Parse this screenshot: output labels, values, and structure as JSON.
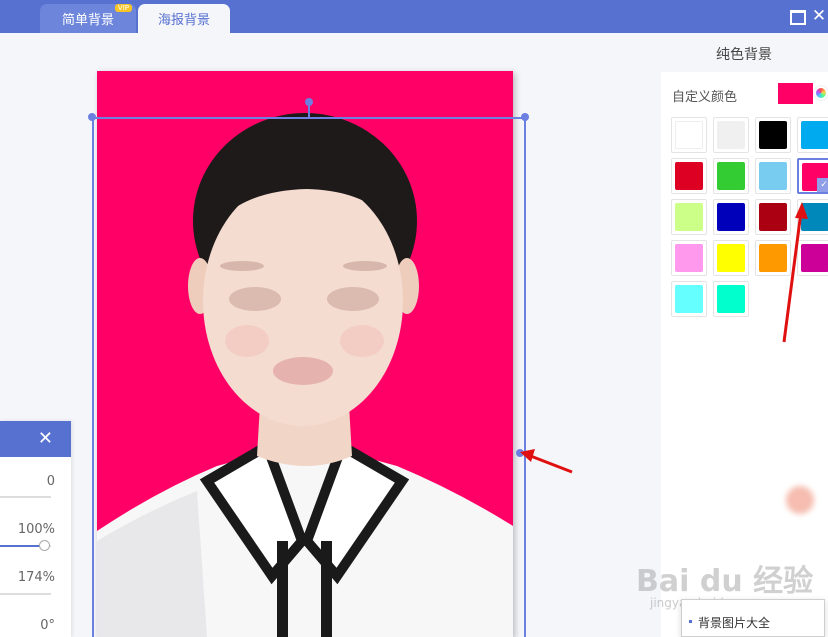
{
  "tabs": [
    {
      "label": "简单背景",
      "badge": "VIP"
    },
    {
      "label": "海报背景"
    }
  ],
  "right_panel": {
    "title": "纯色背景",
    "custom_color_label": "自定义颜色",
    "custom_color": "#ff0066",
    "swatches": [
      "#ffffff",
      "#f0f0f0",
      "#000000",
      "#00aaee",
      "#dd0022",
      "#33cc33",
      "#77ccf0",
      "#ff0066",
      "#ccff88",
      "#0000bb",
      "#aa0011",
      "#0088bb",
      "#ff99ee",
      "#ffff00",
      "#ff9900",
      "#cc0099",
      "#66ffff",
      "#00ffcc"
    ],
    "selected_swatch_index": 7,
    "library_label": "背景图片大全"
  },
  "property_panel": {
    "values": [
      "0",
      "100%",
      "174%",
      "0°"
    ]
  },
  "watermark": {
    "text": "Bai du 经验",
    "sub": "jingyan.baidu.com"
  }
}
